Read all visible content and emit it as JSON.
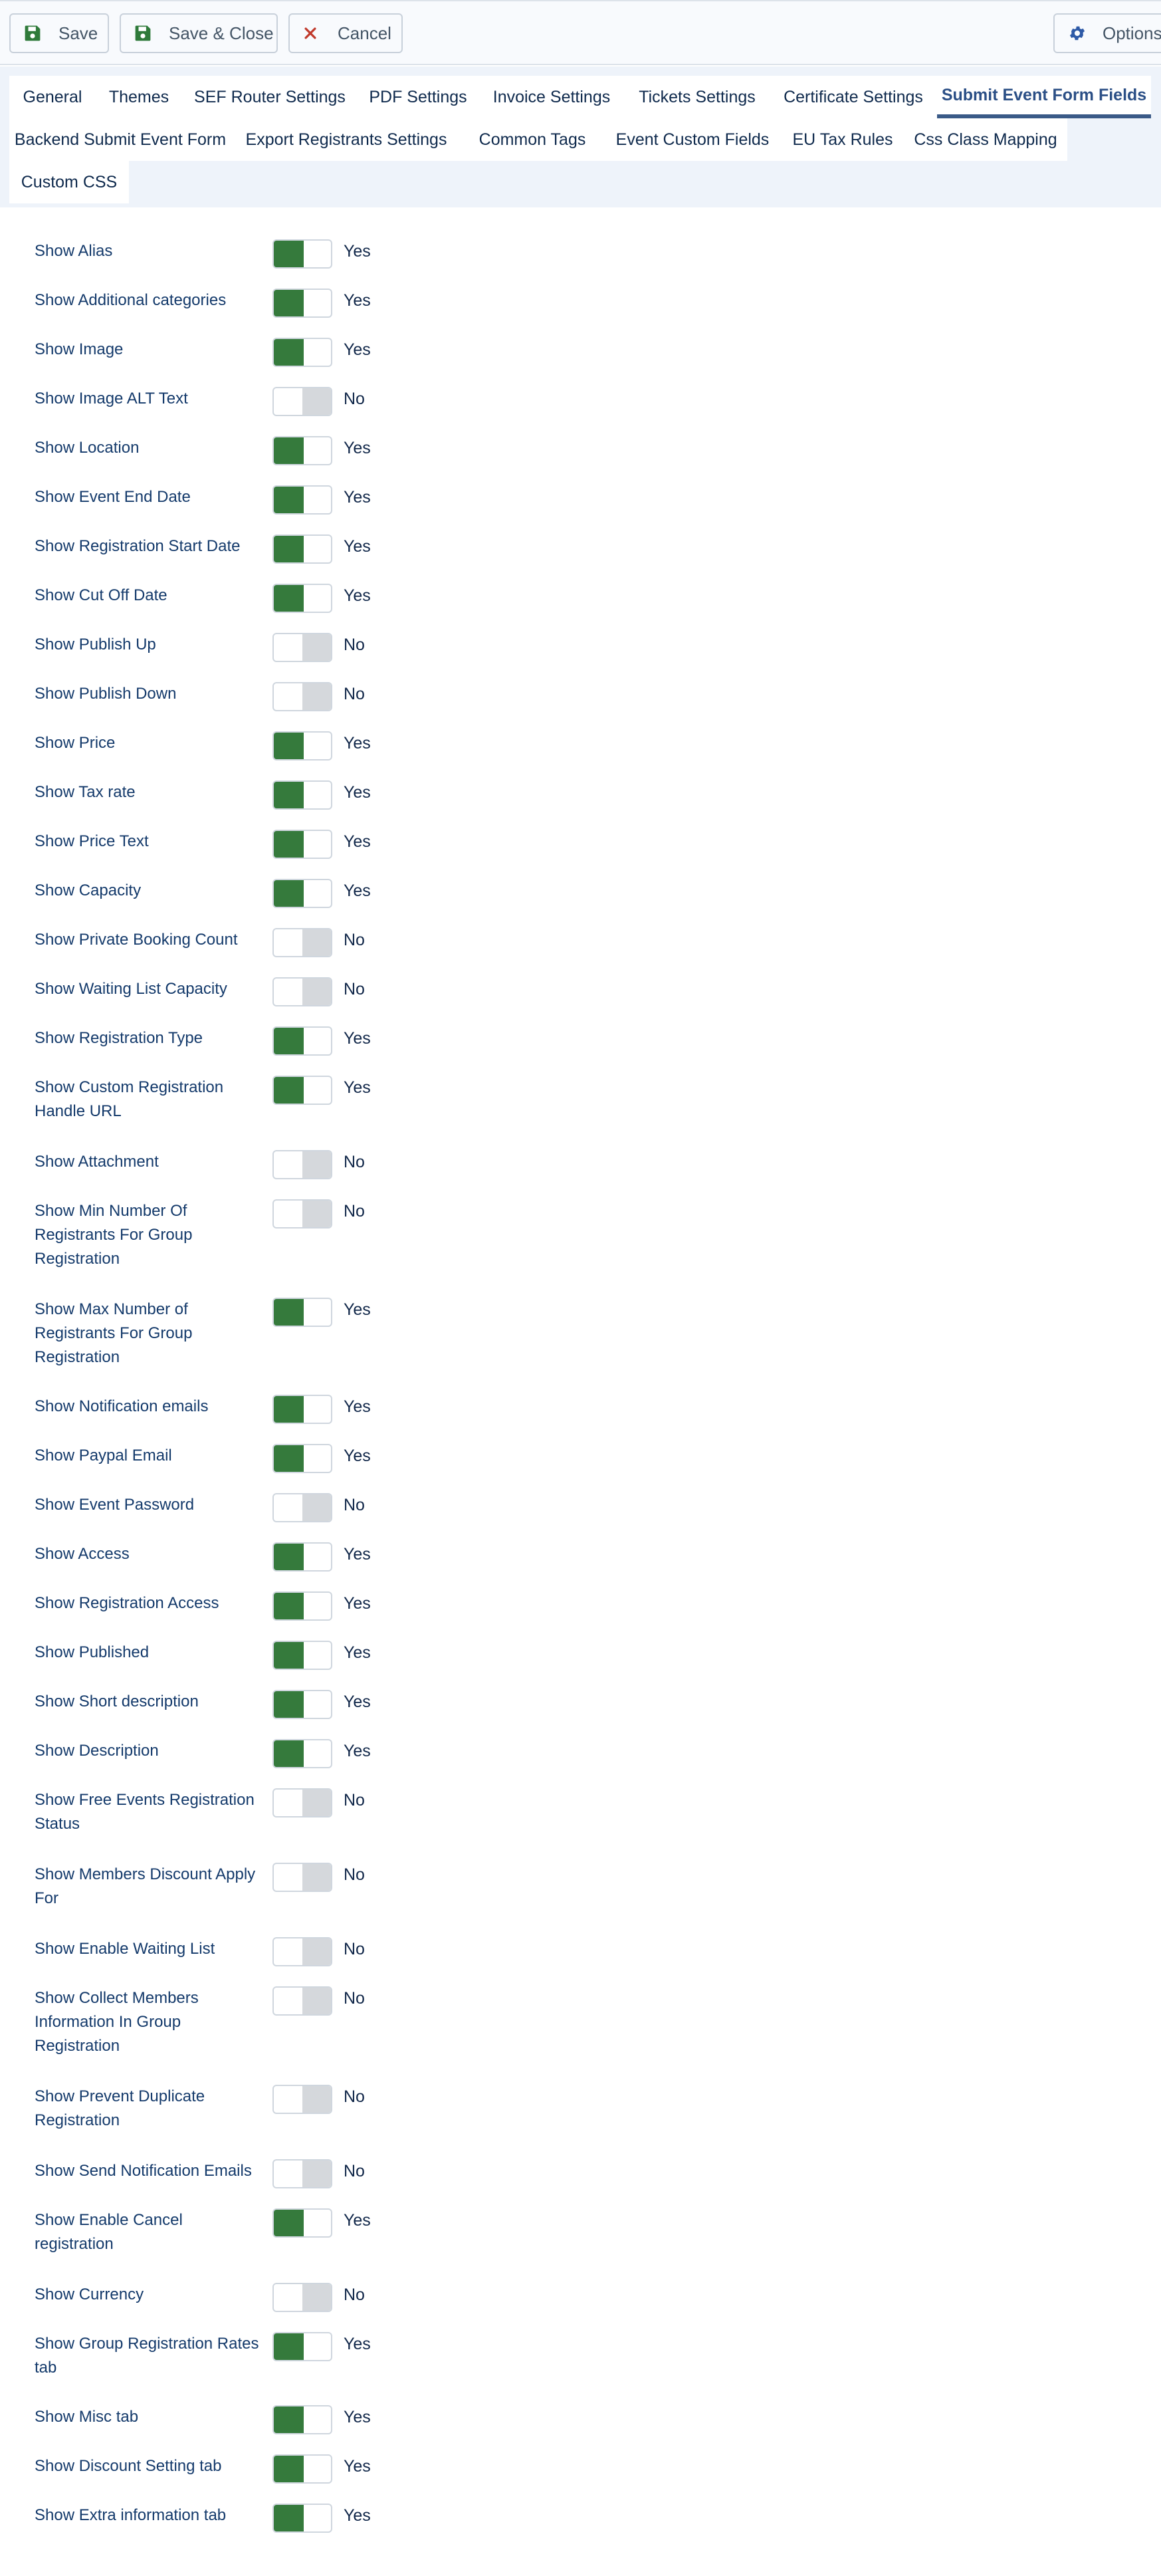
{
  "toolbar": {
    "save_label": "Save",
    "save_close_label": "Save & Close",
    "cancel_label": "Cancel",
    "options_label": "Options"
  },
  "tabs": [
    "General",
    "Themes",
    "SEF Router Settings",
    "PDF Settings",
    "Invoice Settings",
    "Tickets Settings",
    "Certificate Settings",
    "Submit Event Form Fields",
    "Backend Submit Event Form",
    "Export Registrants Settings",
    "Common Tags",
    "Event Custom Fields",
    "EU Tax Rules",
    "Css Class Mapping",
    "Custom CSS"
  ],
  "active_tab": "Submit Event Form Fields",
  "fields": [
    {
      "label": "Show Alias",
      "on": true,
      "value": "Yes"
    },
    {
      "label": "Show Additional categories",
      "on": true,
      "value": "Yes"
    },
    {
      "label": "Show Image",
      "on": true,
      "value": "Yes"
    },
    {
      "label": "Show Image ALT Text",
      "on": false,
      "value": "No"
    },
    {
      "label": "Show Location",
      "on": true,
      "value": "Yes"
    },
    {
      "label": "Show Event End Date",
      "on": true,
      "value": "Yes"
    },
    {
      "label": "Show Registration Start Date",
      "on": true,
      "value": "Yes"
    },
    {
      "label": "Show Cut Off Date",
      "on": true,
      "value": "Yes"
    },
    {
      "label": "Show Publish Up",
      "on": false,
      "value": "No"
    },
    {
      "label": "Show Publish Down",
      "on": false,
      "value": "No"
    },
    {
      "label": "Show Price",
      "on": true,
      "value": "Yes"
    },
    {
      "label": "Show Tax rate",
      "on": true,
      "value": "Yes"
    },
    {
      "label": "Show Price Text",
      "on": true,
      "value": "Yes"
    },
    {
      "label": "Show Capacity",
      "on": true,
      "value": "Yes"
    },
    {
      "label": "Show Private Booking Count",
      "on": false,
      "value": "No"
    },
    {
      "label": "Show Waiting List Capacity",
      "on": false,
      "value": "No"
    },
    {
      "label": "Show Registration Type",
      "on": true,
      "value": "Yes"
    },
    {
      "label": "Show Custom Registration Handle URL",
      "on": true,
      "value": "Yes"
    },
    {
      "label": "Show Attachment",
      "on": false,
      "value": "No"
    },
    {
      "label": "Show Min Number Of Registrants For Group Registration",
      "on": false,
      "value": "No"
    },
    {
      "label": "Show Max Number of Registrants For Group Registration",
      "on": true,
      "value": "Yes"
    },
    {
      "label": "Show Notification emails",
      "on": true,
      "value": "Yes"
    },
    {
      "label": "Show Paypal Email",
      "on": true,
      "value": "Yes"
    },
    {
      "label": "Show Event Password",
      "on": false,
      "value": "No"
    },
    {
      "label": "Show Access",
      "on": true,
      "value": "Yes"
    },
    {
      "label": "Show Registration Access",
      "on": true,
      "value": "Yes"
    },
    {
      "label": "Show Published",
      "on": true,
      "value": "Yes"
    },
    {
      "label": "Show Short description",
      "on": true,
      "value": "Yes"
    },
    {
      "label": "Show Description",
      "on": true,
      "value": "Yes"
    },
    {
      "label": "Show Free Events Registration Status",
      "on": false,
      "value": "No"
    },
    {
      "label": "Show Members Discount Apply For",
      "on": false,
      "value": "No"
    },
    {
      "label": "Show Enable Waiting List",
      "on": false,
      "value": "No"
    },
    {
      "label": "Show Collect Members Information In Group Registration",
      "on": false,
      "value": "No"
    },
    {
      "label": "Show Prevent Duplicate Registration",
      "on": false,
      "value": "No"
    },
    {
      "label": "Show Send Notification Emails",
      "on": false,
      "value": "No"
    },
    {
      "label": "Show Enable Cancel registration",
      "on": true,
      "value": "Yes"
    },
    {
      "label": "Show Currency",
      "on": false,
      "value": "No"
    },
    {
      "label": "Show Group Registration Rates tab",
      "on": true,
      "value": "Yes"
    },
    {
      "label": "Show Misc tab",
      "on": true,
      "value": "Yes"
    },
    {
      "label": "Show Discount Setting tab",
      "on": true,
      "value": "Yes"
    },
    {
      "label": "Show Extra information tab",
      "on": true,
      "value": "Yes"
    }
  ]
}
